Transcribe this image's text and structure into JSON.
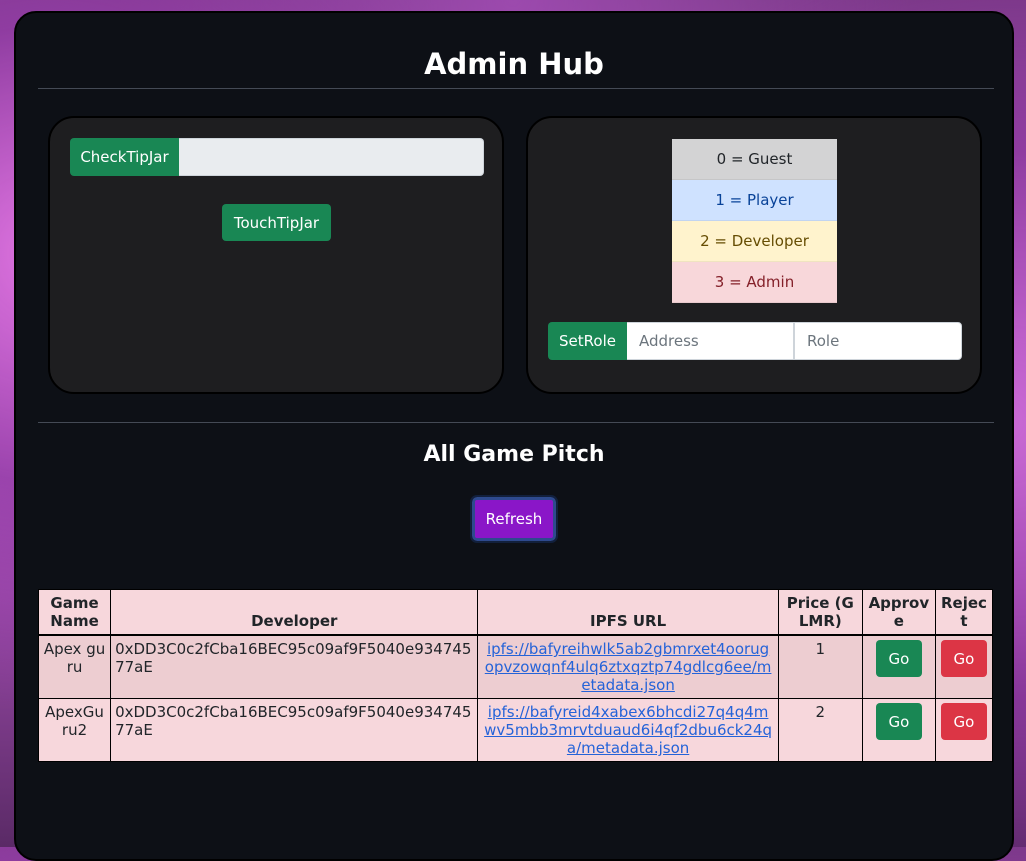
{
  "title": "Admin Hub",
  "tipjar": {
    "check_label": "CheckTipJar",
    "input_value": "",
    "touch_label": "TouchTipJar"
  },
  "roles": [
    {
      "label": "0 = Guest",
      "bg": "#d3d3d4",
      "fg": "#212529"
    },
    {
      "label": "1 = Player",
      "bg": "#cfe2ff",
      "fg": "#084298"
    },
    {
      "label": "2 = Developer",
      "bg": "#fff3cd",
      "fg": "#664d03"
    },
    {
      "label": "3 = Admin",
      "bg": "#f8d7da",
      "fg": "#842029"
    }
  ],
  "setrole": {
    "button_label": "SetRole",
    "address_placeholder": "Address",
    "role_placeholder": "Role"
  },
  "pitch": {
    "heading": "All Game Pitch",
    "refresh_label": "Refresh"
  },
  "table": {
    "headers": [
      "Game Name",
      "Developer",
      "IPFS URL",
      "Price (GLMR)",
      "Approve",
      "Reject"
    ],
    "rows": [
      {
        "name": "Apex guru",
        "developer": "0xDD3C0c2fCba16BEC95c09af9F5040e93474577aE",
        "ipfs": "ipfs://bafyreihwlk5ab2gbmrxet4oorugopvzowqnf4ulq6ztxqztp74gdlcg6ee/metadata.json",
        "price": "1",
        "approve": "Go",
        "reject": "Go"
      },
      {
        "name": "ApexGuru2",
        "developer": "0xDD3C0c2fCba16BEC95c09af9F5040e93474577aE",
        "ipfs": "ipfs://bafyreid4xabex6bhcdi27q4q4mwv5mbb3mrvtduaud6i4qf2dbu6ck24qa/metadata.json",
        "price": "2",
        "approve": "Go",
        "reject": "Go"
      }
    ]
  },
  "colors": {
    "green": "#198754",
    "red": "#dc3545",
    "purple": "#8a16c8",
    "table_bg": "#f7d7dc"
  }
}
